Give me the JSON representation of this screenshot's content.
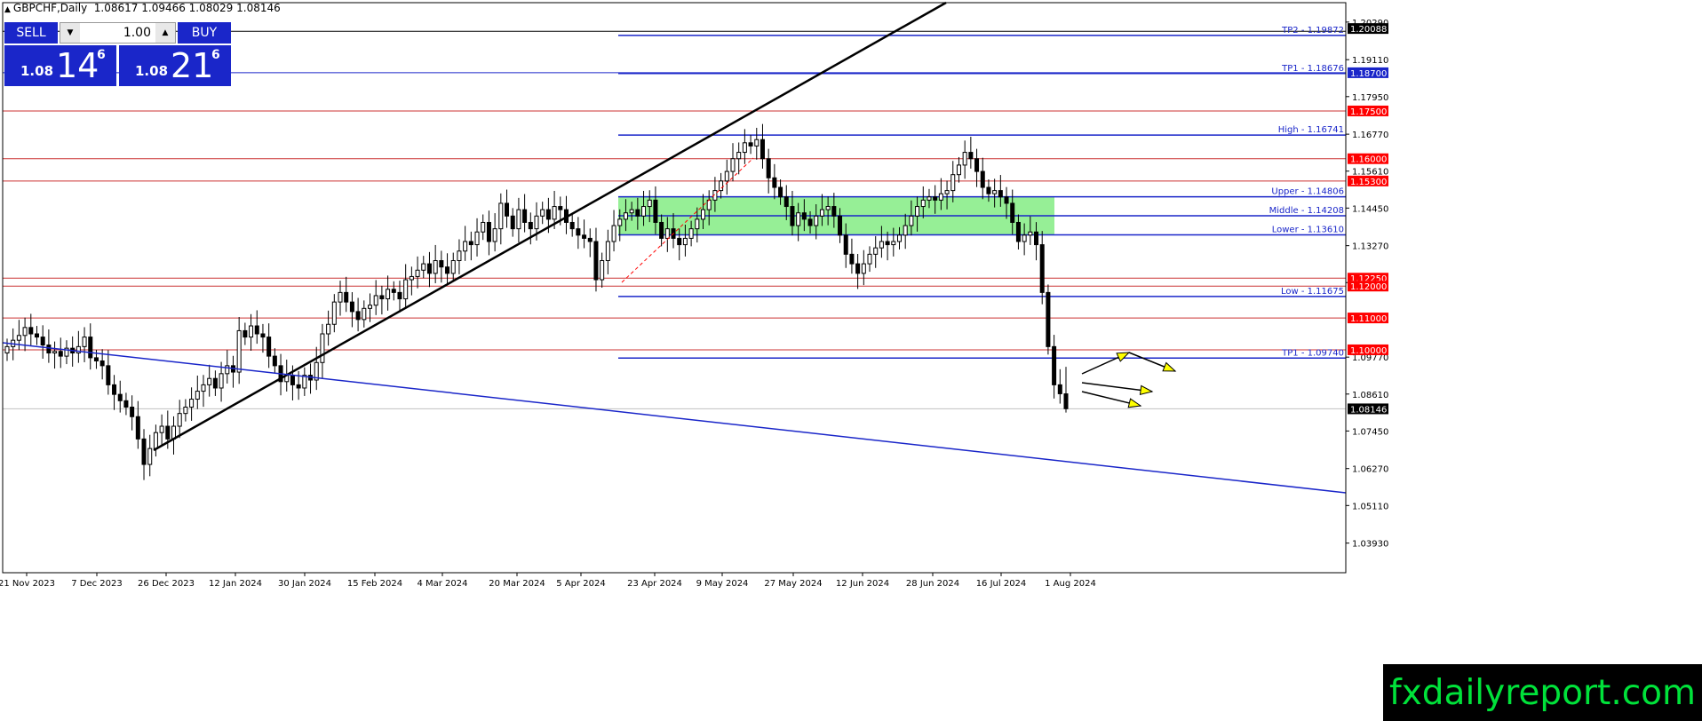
{
  "header": {
    "text": "GBPCHF,Daily  1.08617 1.09466 1.08029 1.08146"
  },
  "trade_panel": {
    "sell_label": "SELL",
    "buy_label": "BUY",
    "lot": "1.00",
    "sell_quote": {
      "big": "1.08",
      "pips": "14",
      "frac": "6"
    },
    "buy_quote": {
      "big": "1.08",
      "pips": "21",
      "frac": "6"
    }
  },
  "brand": "fxdailyreport.com",
  "chart_data": {
    "type": "candlestick",
    "symbol": "GBPCHF",
    "timeframe": "Daily",
    "ohlc_last": {
      "open": 1.08617,
      "high": 1.09466,
      "low": 1.08029,
      "close": 1.08146
    },
    "ylim": [
      1.03,
      1.209
    ],
    "y_ticks": [
      "1.20290",
      "1.19110",
      "1.17950",
      "1.16770",
      "1.15610",
      "1.14450",
      "1.13270",
      "1.12110",
      "1.09770",
      "1.08610",
      "1.07450",
      "1.06270",
      "1.05110",
      "1.03930"
    ],
    "x_ticks": [
      "21 Nov 2023",
      "7 Dec 2023",
      "26 Dec 2023",
      "12 Jan 2024",
      "30 Jan 2024",
      "15 Feb 2024",
      "4 Mar 2024",
      "20 Mar 2024",
      "5 Apr 2024",
      "23 Apr 2024",
      "9 May 2024",
      "27 May 2024",
      "12 Jun 2024",
      "28 Jun 2024",
      "16 Jul 2024",
      "1 Aug 2024"
    ],
    "closes": [
      1.101,
      1.103,
      1.1045,
      1.107,
      1.105,
      1.104,
      1.1015,
      1.099,
      1.0995,
      1.098,
      1.1005,
      1.099,
      1.101,
      1.104,
      1.0975,
      1.0965,
      1.095,
      1.089,
      1.086,
      1.084,
      1.082,
      1.079,
      1.072,
      1.064,
      1.069,
      1.074,
      1.076,
      1.072,
      1.076,
      1.08,
      1.082,
      1.0845,
      1.087,
      1.089,
      1.091,
      1.088,
      1.0925,
      1.095,
      1.093,
      1.106,
      1.104,
      1.1075,
      1.105,
      1.104,
      1.098,
      1.095,
      1.09,
      1.092,
      1.089,
      1.088,
      1.092,
      1.0905,
      1.096,
      1.105,
      1.108,
      1.115,
      1.118,
      1.115,
      1.112,
      1.1095,
      1.113,
      1.114,
      1.117,
      1.116,
      1.119,
      1.118,
      1.116,
      1.122,
      1.123,
      1.125,
      1.127,
      1.124,
      1.128,
      1.126,
      1.124,
      1.128,
      1.131,
      1.134,
      1.133,
      1.137,
      1.14,
      1.134,
      1.138,
      1.146,
      1.142,
      1.138,
      1.144,
      1.14,
      1.138,
      1.142,
      1.144,
      1.141,
      1.145,
      1.144,
      1.14,
      1.138,
      1.136,
      1.135,
      1.134,
      1.122,
      1.128,
      1.134,
      1.139,
      1.141,
      1.143,
      1.144,
      1.142,
      1.145,
      1.147,
      1.14,
      1.135,
      1.138,
      1.135,
      1.133,
      1.135,
      1.138,
      1.141,
      1.144,
      1.147,
      1.15,
      1.153,
      1.156,
      1.16,
      1.162,
      1.165,
      1.164,
      1.166,
      1.16,
      1.154,
      1.151,
      1.148,
      1.145,
      1.139,
      1.143,
      1.141,
      1.139,
      1.142,
      1.144,
      1.145,
      1.142,
      1.136,
      1.13,
      1.127,
      1.124,
      1.127,
      1.13,
      1.132,
      1.134,
      1.133,
      1.134,
      1.136,
      1.139,
      1.142,
      1.145,
      1.147,
      1.148,
      1.147,
      1.149,
      1.15,
      1.155,
      1.158,
      1.162,
      1.16,
      1.156,
      1.151,
      1.149,
      1.15,
      1.148,
      1.146,
      1.14,
      1.134,
      1.136,
      1.137,
      1.133,
      1.118,
      1.101,
      1.089,
      1.0862,
      1.0815
    ],
    "indicator_levels": [
      {
        "name": "TP2",
        "value": 1.19872,
        "label": "TP2 - 1.19872"
      },
      {
        "name": "TP1",
        "value": 1.18676,
        "label": "TP1 - 1.18676"
      },
      {
        "name": "High",
        "value": 1.16741,
        "label": "High - 1.16741"
      },
      {
        "name": "Upper",
        "value": 1.14806,
        "label": "Upper - 1.14806"
      },
      {
        "name": "Middle",
        "value": 1.14208,
        "label": "Middle - 1.14208"
      },
      {
        "name": "Lower",
        "value": 1.1361,
        "label": "Lower - 1.13610"
      },
      {
        "name": "Low",
        "value": 1.11675,
        "label": "Low - 1.11675"
      },
      {
        "name": "TP1",
        "value": 1.0974,
        "label": "TP1 - 1.09740"
      }
    ],
    "horizontal_levels": [
      1.2,
      1.187,
      1.175,
      1.16,
      1.153,
      1.1225,
      1.12,
      1.11,
      1.1
    ],
    "tag_labels": [
      {
        "text": "1.20088",
        "color": "#000000"
      },
      {
        "text": "1.18700",
        "color": "#1a26c9"
      },
      {
        "text": "1.17500",
        "color": "#ff0000"
      },
      {
        "text": "1.16000",
        "color": "#ff0000"
      },
      {
        "text": "1.15300",
        "color": "#ff0000"
      },
      {
        "text": "1.12250",
        "color": "#ff0000"
      },
      {
        "text": "1.12000",
        "color": "#ff0000"
      },
      {
        "text": "1.11000",
        "color": "#ff0000"
      },
      {
        "text": "1.10000",
        "color": "#ff0000"
      },
      {
        "text": "1.08146",
        "color": "#000000"
      }
    ],
    "colors": {
      "level_red": "#cc3333",
      "level_blue": "#1a26c9",
      "zone": "#90ee90",
      "trend_black": "#000000",
      "trend_blue": "#1a26c9",
      "arrow": "#ffff00"
    }
  }
}
